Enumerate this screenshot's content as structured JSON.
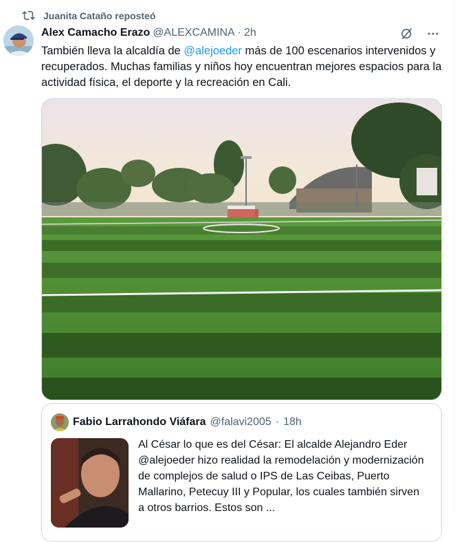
{
  "repost": {
    "label": "Juanita Cataño reposteó"
  },
  "tweet": {
    "author_name": "Alex Camacho Erazo",
    "handle": "@ALEXCAMINA",
    "separator": "·",
    "time": "2h",
    "text_before": "También lleva la alcaldía de ",
    "mention": "@alejoeder",
    "text_after": " más de 100 escenarios intervenidos y recuperados. Muchas familias y niños hoy encuentran mejores espacios para la actividad física, el deporte y la recreación en Cali.",
    "icons": {
      "grok": "grok-icon",
      "more": "more-icon",
      "repost": "repost-icon"
    }
  },
  "quote": {
    "author_name": "Fabio Larrahondo Viáfara",
    "handle": "@falavi2005",
    "separator": "·",
    "time": "18h",
    "text": "Al César lo que es del César: El alcalde Alejandro Eder @alejoeder hizo realidad la remodelación y modernización de complejos de salud o IPS de Las Ceibas, Puerto Mallarino, Petecuy III y Popular, los cuales también sirven a otros barrios. Estos son ..."
  },
  "colors": {
    "text": "#0f1419",
    "muted": "#536471",
    "accent": "#1d9bf0",
    "border": "#cfd9de"
  }
}
